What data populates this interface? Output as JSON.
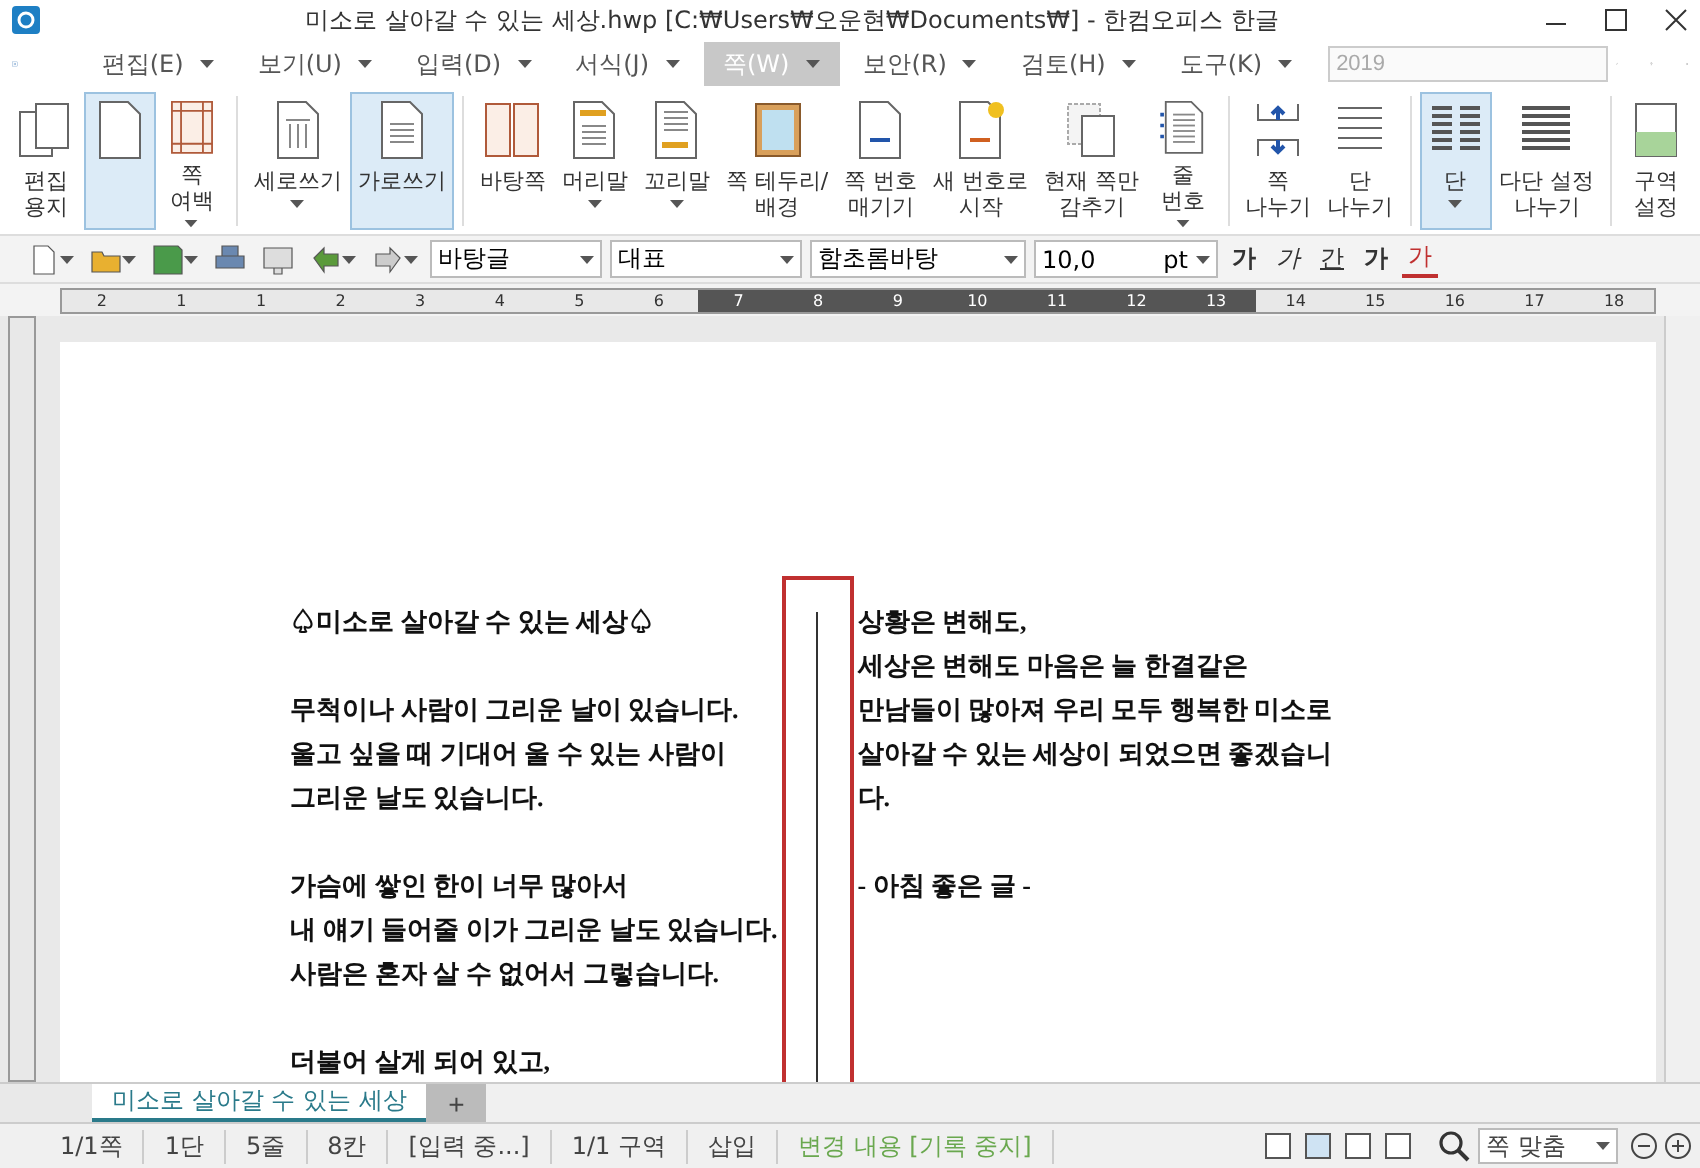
{
  "window": {
    "title": "미소로 살아갈 수 있는 세상.hwp [C:₩Users₩오운현₩Documents₩] - 한컴오피스 한글"
  },
  "menu": [
    {
      "label": "편집(E)",
      "selected": false
    },
    {
      "label": "보기(U)",
      "selected": false
    },
    {
      "label": "입력(D)",
      "selected": false
    },
    {
      "label": "서식(J)",
      "selected": false
    },
    {
      "label": "쪽(W)",
      "selected": true
    },
    {
      "label": "보안(R)",
      "selected": false
    },
    {
      "label": "검토(H)",
      "selected": false
    },
    {
      "label": "도구(K)",
      "selected": false
    }
  ],
  "version_field": {
    "value": "2019"
  },
  "ribbon": [
    {
      "kind": "pages",
      "label": "편집\n용지",
      "selected": false,
      "dropdown": false,
      "group_end": false
    },
    {
      "kind": "page",
      "selected": true,
      "dropdown": false,
      "group_end": false
    },
    {
      "kind": "margin",
      "label": "쪽\n여백",
      "selected": false,
      "dropdown": true,
      "group_end": true
    },
    {
      "kind": "vertical",
      "label": "세로쓰기",
      "selected": false,
      "dropdown": true,
      "group_end": false
    },
    {
      "kind": "horizontal",
      "label": "가로쓰기",
      "selected": true,
      "dropdown": false,
      "group_end": true
    },
    {
      "kind": "master",
      "label": "바탕쪽",
      "selected": false,
      "dropdown": false,
      "group_end": false
    },
    {
      "kind": "header",
      "label": "머리말",
      "selected": false,
      "dropdown": true,
      "group_end": false
    },
    {
      "kind": "footer",
      "label": "꼬리말",
      "selected": false,
      "dropdown": true,
      "group_end": false
    },
    {
      "kind": "border",
      "label": "쪽 테두리/\n배경",
      "selected": false,
      "dropdown": false,
      "group_end": false
    },
    {
      "kind": "pagenum",
      "label": "쪽 번호\n매기기",
      "selected": false,
      "dropdown": false,
      "group_end": false
    },
    {
      "kind": "newnum",
      "label": "새 번호로\n시작",
      "selected": false,
      "dropdown": false,
      "group_end": false
    },
    {
      "kind": "hide",
      "label": "현재 쪽만\n감추기",
      "selected": false,
      "dropdown": false,
      "group_end": false
    },
    {
      "kind": "linenum",
      "label": "줄\n번호",
      "selected": false,
      "dropdown": true,
      "group_end": true
    },
    {
      "kind": "pagebreak",
      "label": "쪽\n나누기",
      "selected": false,
      "dropdown": false,
      "group_end": false
    },
    {
      "kind": "colbreak",
      "label": "단\n나누기",
      "selected": false,
      "dropdown": false,
      "group_end": true
    },
    {
      "kind": "columns",
      "label": "단",
      "selected": true,
      "dropdown": true,
      "group_end": false
    },
    {
      "kind": "multicol",
      "label": "다단 설정\n나누기",
      "selected": false,
      "dropdown": false,
      "group_end": true
    },
    {
      "kind": "section",
      "label": "구역\n설정",
      "selected": false,
      "dropdown": false
    }
  ],
  "toolbar": {
    "style": "바탕글",
    "language": "대표",
    "font": "함초롬바탕",
    "size": "10,0",
    "unit": "pt",
    "char_buttons": [
      "가",
      "가",
      "간",
      "가",
      "가"
    ]
  },
  "ruler": {
    "ticks": [
      "2",
      "1",
      "1",
      "2",
      "3",
      "4",
      "5",
      "6",
      "7",
      "8",
      "9",
      "10",
      "11",
      "12",
      "13",
      "14",
      "15",
      "16",
      "17",
      "18"
    ]
  },
  "document": {
    "columns": [
      {
        "paragraphs": [
          [
            "♤미소로 살아갈 수 있는 세상♤"
          ],
          [
            "무척이나 사람이 그리운 날이 있습니다.",
            "울고 싶을 때 기대어 울 수 있는 사람이",
            "그리운 날도 있습니다."
          ],
          [
            "가슴에 쌓인 한이 너무 많아서",
            "내 얘기 들어줄 이가 그리운 날도 있습니다.",
            "사람은 혼자 살 수 없어서 그렇습니다."
          ],
          [
            "더불어 살게 되어 있고,"
          ]
        ]
      },
      {
        "paragraphs": [
          [
            "상황은 변해도,",
            "세상은 변해도 마음은 늘 한결같은",
            "만남들이 많아져 우리 모두 행복한 미소로",
            "살아갈 수 있는 세상이 되었으면 좋겠습니",
            "다."
          ],
          [
            "- 아침 좋은 글 -"
          ]
        ]
      }
    ],
    "separator_selected": true
  },
  "tabs": [
    {
      "label": "미소로 살아갈 수 있는 세상",
      "selected": true
    }
  ],
  "add_tab": "+",
  "status_bar": {
    "items": [
      "1/1쪽",
      "1단",
      "5줄",
      "8칸",
      "[입력 중...]",
      "1/1 구역",
      "삽입"
    ],
    "track_changes": "변경 내용 [기록 중지]",
    "zoom": "쪽 맞춤"
  }
}
